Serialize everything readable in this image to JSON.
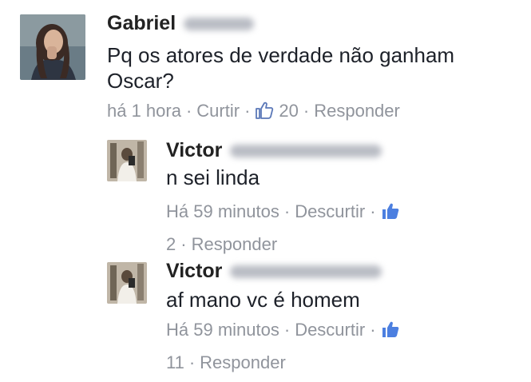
{
  "comments": [
    {
      "author_first": "Gabriel",
      "text": "Pq os atores de verdade não ganham Oscar?",
      "time": "há 1 hora",
      "action": "Curtir",
      "likes": "20",
      "reply": "Responder"
    },
    {
      "author_first": "Victor",
      "text": "n sei linda",
      "time": "Há 59 minutos",
      "action": "Descurtir",
      "likes": "2",
      "reply": "Responder"
    },
    {
      "author_first": "Victor",
      "text": "af mano vc é homem",
      "time": "Há 59 minutos",
      "action": "Descurtir",
      "likes": "11",
      "reply": "Responder"
    }
  ],
  "separator": "·",
  "icons": {
    "like": "thumbs-up-icon"
  },
  "colors": {
    "meta_text": "#90949c",
    "like_outline": "#5b78b8",
    "like_filled": "#4c7fe0"
  }
}
